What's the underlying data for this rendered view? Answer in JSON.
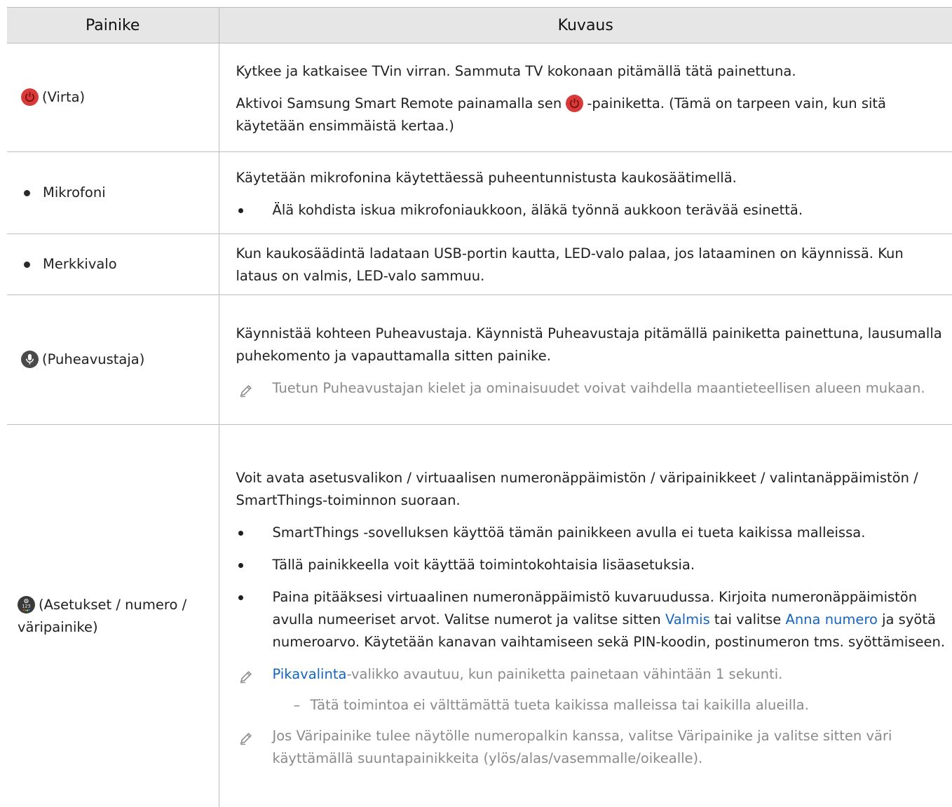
{
  "header": {
    "col_button": "Painike",
    "col_desc": "Kuvaus"
  },
  "rows": [
    {
      "label": "(Virta)",
      "icon": "power-icon",
      "p1": "Kytkee ja katkaisee TVin virran. Sammuta TV kokonaan pitämällä tätä painettuna.",
      "p2_a": "Aktivoi Samsung Smart Remote painamalla sen ",
      "p2_b": "-painiketta. (Tämä on tarpeen vain, kun sitä käytetään ensimmäistä kertaa.)"
    },
    {
      "label": "Mikrofoni",
      "icon": "bullet-dot",
      "p1": "Käytetään mikrofonina käytettäessä puheentunnistusta kaukosäätimellä.",
      "bullet1": "Älä kohdista iskua mikrofoniaukkoon, äläkä työnnä aukkoon terävää esinettä."
    },
    {
      "label": "Merkkivalo",
      "icon": "bullet-dot",
      "p1": "Kun kaukosäädintä ladataan USB-portin kautta, LED-valo palaa, jos lataaminen on käynnissä. Kun lataus on valmis, LED-valo sammuu."
    },
    {
      "label": "(Puheavustaja)",
      "icon": "microphone-icon",
      "p1": "Käynnistää kohteen Puheavustaja. Käynnistä Puheavustaja pitämällä painiketta painettuna, lausumalla puhekomento ja vapauttamalla sitten painike.",
      "note1": "Tuetun Puheavustajan kielet ja ominaisuudet voivat vaihdella maantieteellisen alueen mukaan."
    },
    {
      "label": "(Asetukset / numero / väripainike)",
      "icon": "settings-number-icon",
      "p1": "Voit avata asetusvalikon / virtuaalisen numeronäppäimistön / väripainikkeet / valintanäppäimistön / SmartThings-toiminnon suoraan.",
      "bullet1": "SmartThings -sovelluksen käyttöä tämän painikkeen avulla ei tueta kaikissa malleissa.",
      "bullet2": "Tällä painikkeella voit käyttää toimintokohtaisia lisäasetuksia.",
      "bullet3_a": "Paina pitääksesi virtuaalinen numeronäppäimistö kuvaruudussa. Kirjoita numeronäppäimistön avulla numeeriset arvot. Valitse numerot ja valitse sitten ",
      "bullet3_link1": "Valmis",
      "bullet3_b": " tai valitse ",
      "bullet3_link2": "Anna numero",
      "bullet3_c": " ja syötä numeroarvo. Käytetään kanavan vaihtamiseen sekä PIN-koodin, postinumeron tms. syöttämiseen.",
      "note1_link": "Pikavalinta",
      "note1_text": "-valikko avautuu, kun painiketta painetaan vähintään 1 sekunti.",
      "subnote1": "Tätä toimintoa ei välttämättä tueta kaikissa malleissa tai kaikilla alueilla.",
      "note2": "Jos Väripainike tulee näytölle numeropalkin kanssa, valitse Väripainike ja valitse sitten väri käyttämällä suuntapainikkeita (ylös/alas/vasemmalle/oikealle).",
      "dash": "–"
    }
  ],
  "colors": {
    "header_bg": "#e6e6e6",
    "link": "#1565c0",
    "note": "#8a8a8a",
    "power": "#d83a3a"
  }
}
